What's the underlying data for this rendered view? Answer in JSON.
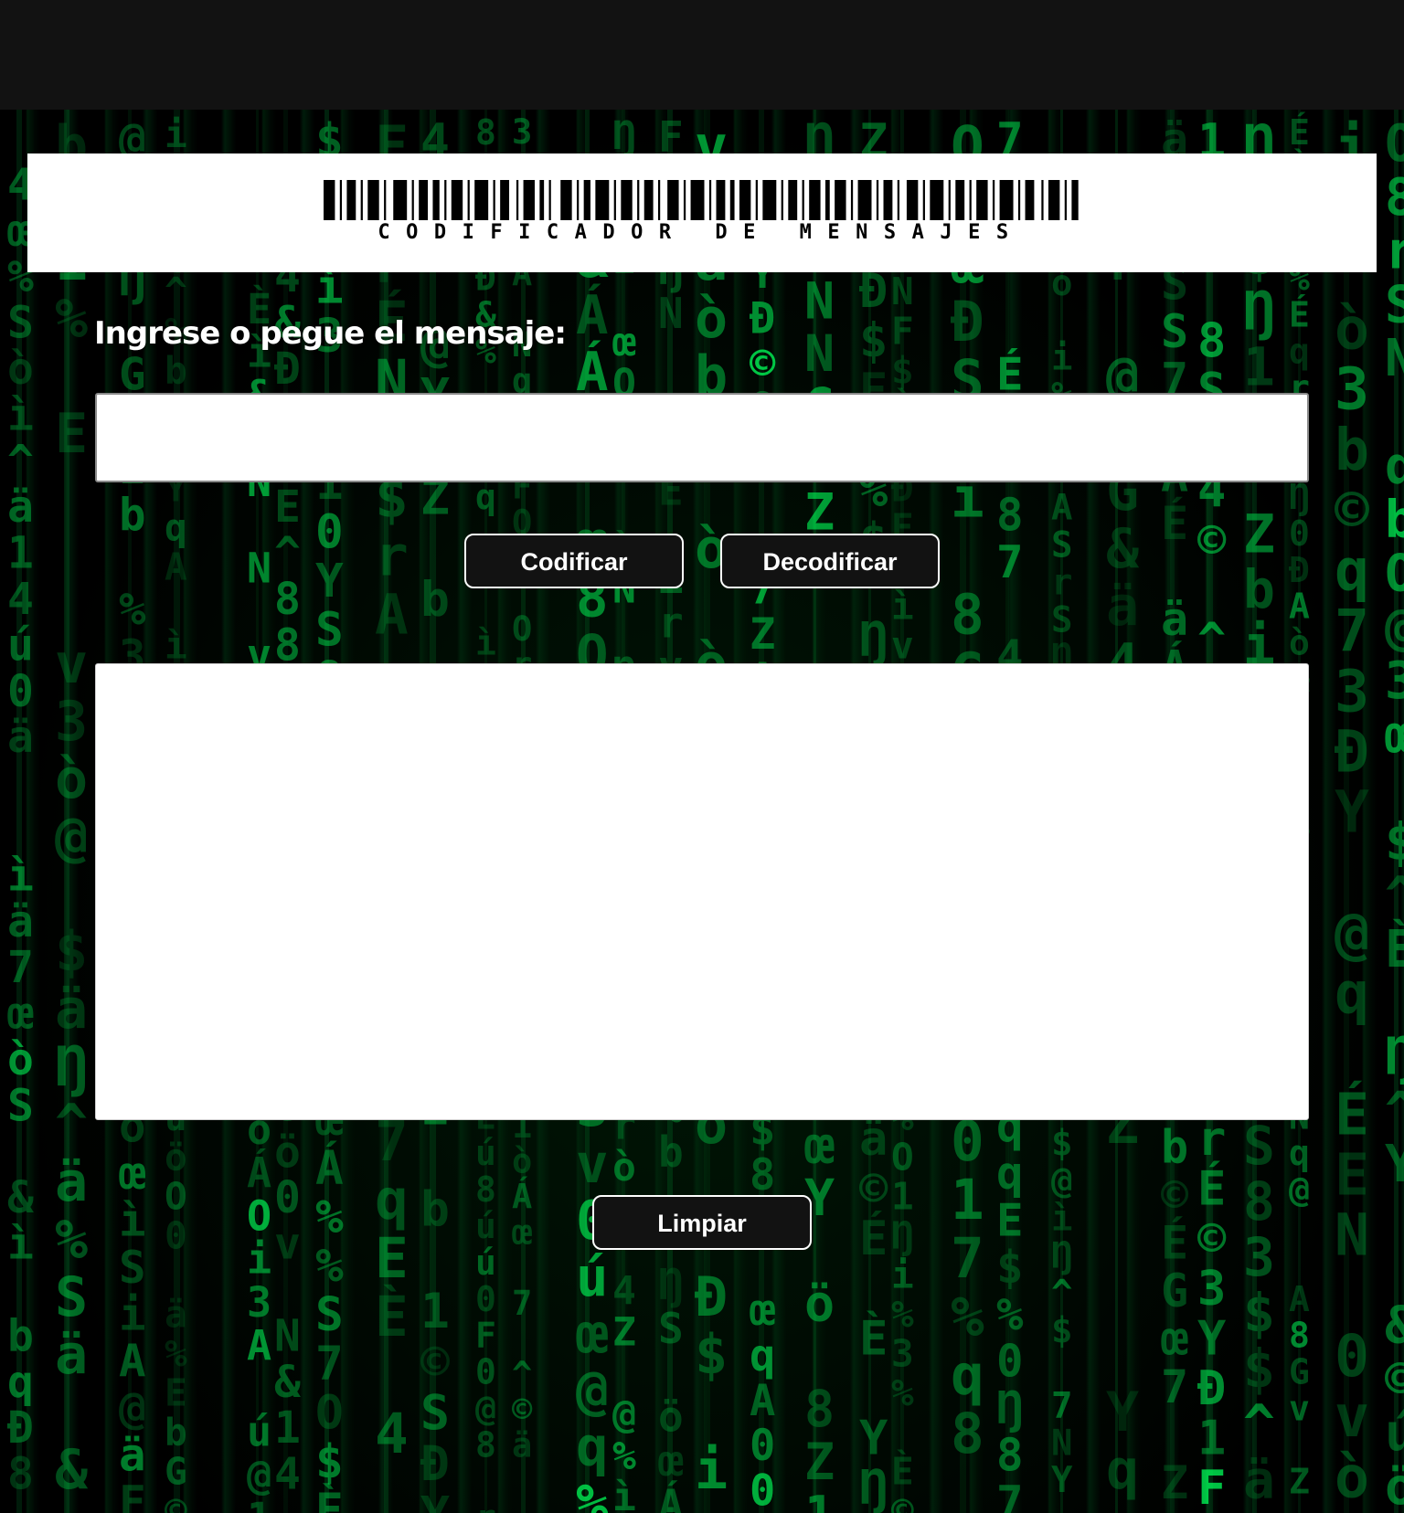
{
  "header": {
    "logo_caption": "CODIFICADOR DE MENSAJES"
  },
  "form": {
    "prompt_label": "Ingrese o pegue el mensaje:",
    "input_value": "",
    "output_value": ""
  },
  "actions": {
    "encode_label": "Codificar",
    "decode_label": "Decodificar",
    "clear_label": "Limpiar"
  },
  "theme": {
    "accent": "#00c853",
    "button_bg": "#121212",
    "top_bar": "#121212"
  },
  "background": {
    "glyphs": [
      "N",
      "Z",
      "4",
      "b",
      "v",
      "1",
      "$",
      "O",
      "G",
      "7",
      "œ",
      "Á",
      "É",
      "@",
      "&",
      "ö",
      "ä",
      "ú",
      "%",
      "Ŋ",
      "S",
      "q",
      "A",
      "r",
      "^",
      "©",
      "8",
      "3",
      "0",
      "E",
      "i",
      "Y",
      "F",
      "Đ",
      "ò",
      "ì",
      "È"
    ]
  }
}
